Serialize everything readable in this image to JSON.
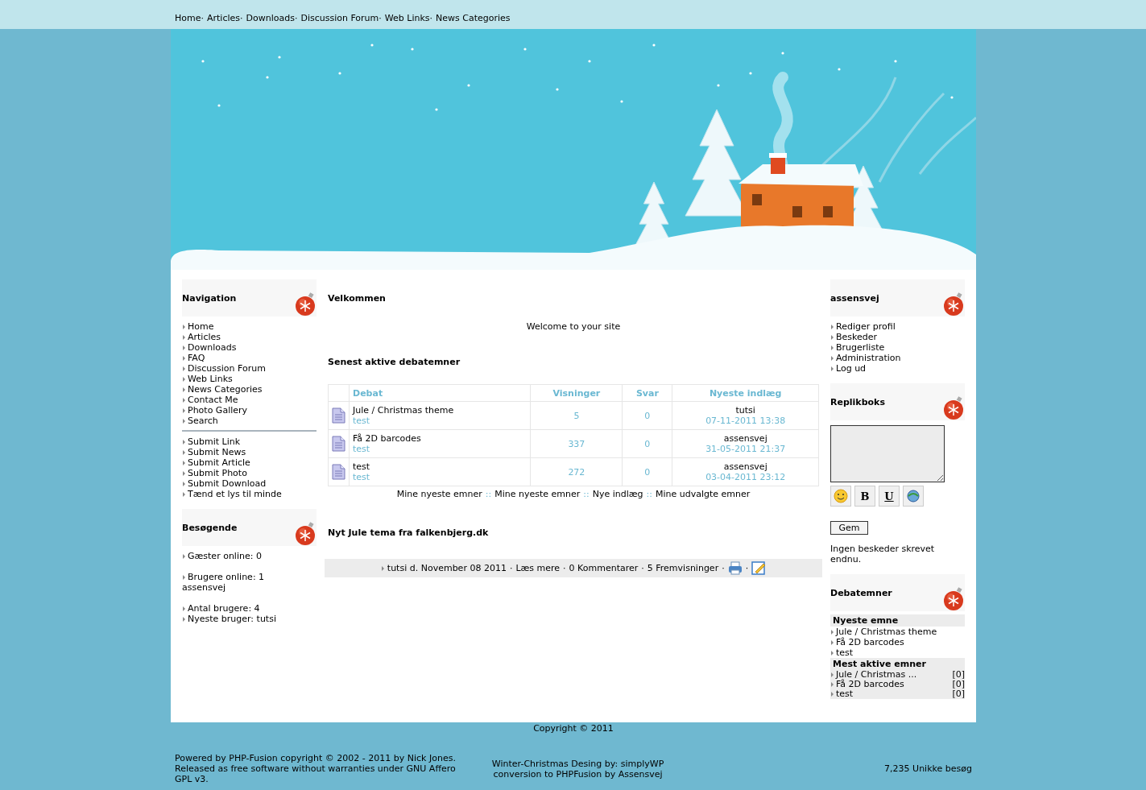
{
  "top_nav": [
    {
      "kind": "link",
      "text": "Home"
    },
    {
      "kind": "sep",
      "text": "·"
    },
    {
      "kind": "link",
      "text": "Articles"
    },
    {
      "kind": "sep",
      "text": "·"
    },
    {
      "kind": "link",
      "text": "Downloads"
    },
    {
      "kind": "sep",
      "text": "·"
    },
    {
      "kind": "link",
      "text": "Discussion Forum"
    },
    {
      "kind": "sep",
      "text": "·"
    },
    {
      "kind": "link",
      "text": "Web Links"
    },
    {
      "kind": "sep",
      "text": "·"
    },
    {
      "kind": "link",
      "text": "News Categories"
    }
  ],
  "navigation": {
    "title": "Navigation",
    "groups": [
      [
        "Home",
        "Articles",
        "Downloads",
        "FAQ",
        "Discussion Forum",
        "Web Links",
        "News Categories",
        "Contact Me",
        "Photo Gallery",
        "Search"
      ],
      [
        "Submit Link",
        "Submit News",
        "Submit Article",
        "Submit Photo",
        "Submit Download",
        "Tænd et lys til minde"
      ]
    ]
  },
  "visitors": {
    "title": "Besøgende",
    "groups": [
      [
        {
          "kind": "bullet",
          "text": "Gæster online: 0"
        }
      ],
      [
        {
          "kind": "bullet",
          "text": "Brugere online: 1"
        },
        {
          "kind": "plain",
          "text": "assensvej"
        }
      ],
      [
        {
          "kind": "bullet",
          "text": "Antal brugere: 4"
        },
        {
          "kind": "bullet",
          "text": "Nyeste bruger: tutsi"
        }
      ]
    ]
  },
  "welcome": {
    "title": "Velkommen",
    "text": "Welcome to your site"
  },
  "forum": {
    "title": "Senest aktive debatemner",
    "columns": [
      "Debat",
      "Visninger",
      "Svar",
      "Nyeste indlæg"
    ],
    "rows": [
      {
        "title": "Jule / Christmas theme",
        "forum": "test",
        "views": "5",
        "replies": "0",
        "last_user": "tutsi",
        "last_date": "07-11-2011 13:38"
      },
      {
        "title": "Få 2D barcodes",
        "forum": "test",
        "views": "337",
        "replies": "0",
        "last_user": "assensvej",
        "last_date": "31-05-2011 21:37"
      },
      {
        "title": "test",
        "forum": "test",
        "views": "272",
        "replies": "0",
        "last_user": "assensvej",
        "last_date": "03-04-2011 23:12"
      }
    ],
    "links": [
      {
        "kind": "link",
        "text": "Mine nyeste emner"
      },
      {
        "kind": "sep",
        "text": "::"
      },
      {
        "kind": "link",
        "text": "Mine nyeste emner"
      },
      {
        "kind": "sep",
        "text": "::"
      },
      {
        "kind": "link",
        "text": "Nye indlæg"
      },
      {
        "kind": "sep",
        "text": "::"
      },
      {
        "kind": "link",
        "text": "Mine udvalgte emner"
      }
    ]
  },
  "news": {
    "title": "Nyt Jule tema fra falkenbjerg.dk",
    "meta": [
      {
        "kind": "text",
        "text": "tutsi d. November 08 2011"
      },
      {
        "kind": "sep",
        "text": "·"
      },
      {
        "kind": "link",
        "text": "Læs mere"
      },
      {
        "kind": "sep",
        "text": "·"
      },
      {
        "kind": "text",
        "text": "0 Kommentarer"
      },
      {
        "kind": "sep",
        "text": "·"
      },
      {
        "kind": "text",
        "text": "5 Fremvisninger"
      },
      {
        "kind": "sep",
        "text": "·"
      },
      {
        "kind": "print"
      },
      {
        "kind": "sep",
        "text": "·"
      },
      {
        "kind": "edit"
      }
    ]
  },
  "user": {
    "title": "assensvej",
    "items": [
      "Rediger profil",
      "Beskeder",
      "Brugerliste",
      "Administration",
      "Log ud"
    ]
  },
  "shoutbox": {
    "title": "Replikboks",
    "toolbar": [
      {
        "kind": "smiley"
      },
      {
        "kind": "bold",
        "label": "B"
      },
      {
        "kind": "underline",
        "label": "U"
      },
      {
        "kind": "url"
      }
    ],
    "button": "Gem",
    "empty_text": "Ingen beskeder skrevet endnu."
  },
  "debates": {
    "title": "Debatemner",
    "newest_title": "Nyeste emne",
    "newest": [
      "Jule / Christmas theme",
      "Få 2D barcodes",
      "test"
    ],
    "active_title": "Mest aktive emner",
    "active": [
      {
        "title": "Jule / Christmas ...",
        "count": "[0]"
      },
      {
        "title": "Få 2D barcodes",
        "count": "[0]"
      },
      {
        "title": "test",
        "count": "[0]"
      }
    ]
  },
  "footer": {
    "copyright": "Copyright © 2011",
    "powered": "Powered by PHP-Fusion copyright © 2002 - 2011 by Nick Jones. Released as free software without warranties under GNU Affero GPL v3.",
    "design": [
      "Winter-Christmas Desing by: simplyWP",
      "conversion to PHPFusion by Assensvej"
    ],
    "visits": "7,235 Unikke besøg"
  }
}
